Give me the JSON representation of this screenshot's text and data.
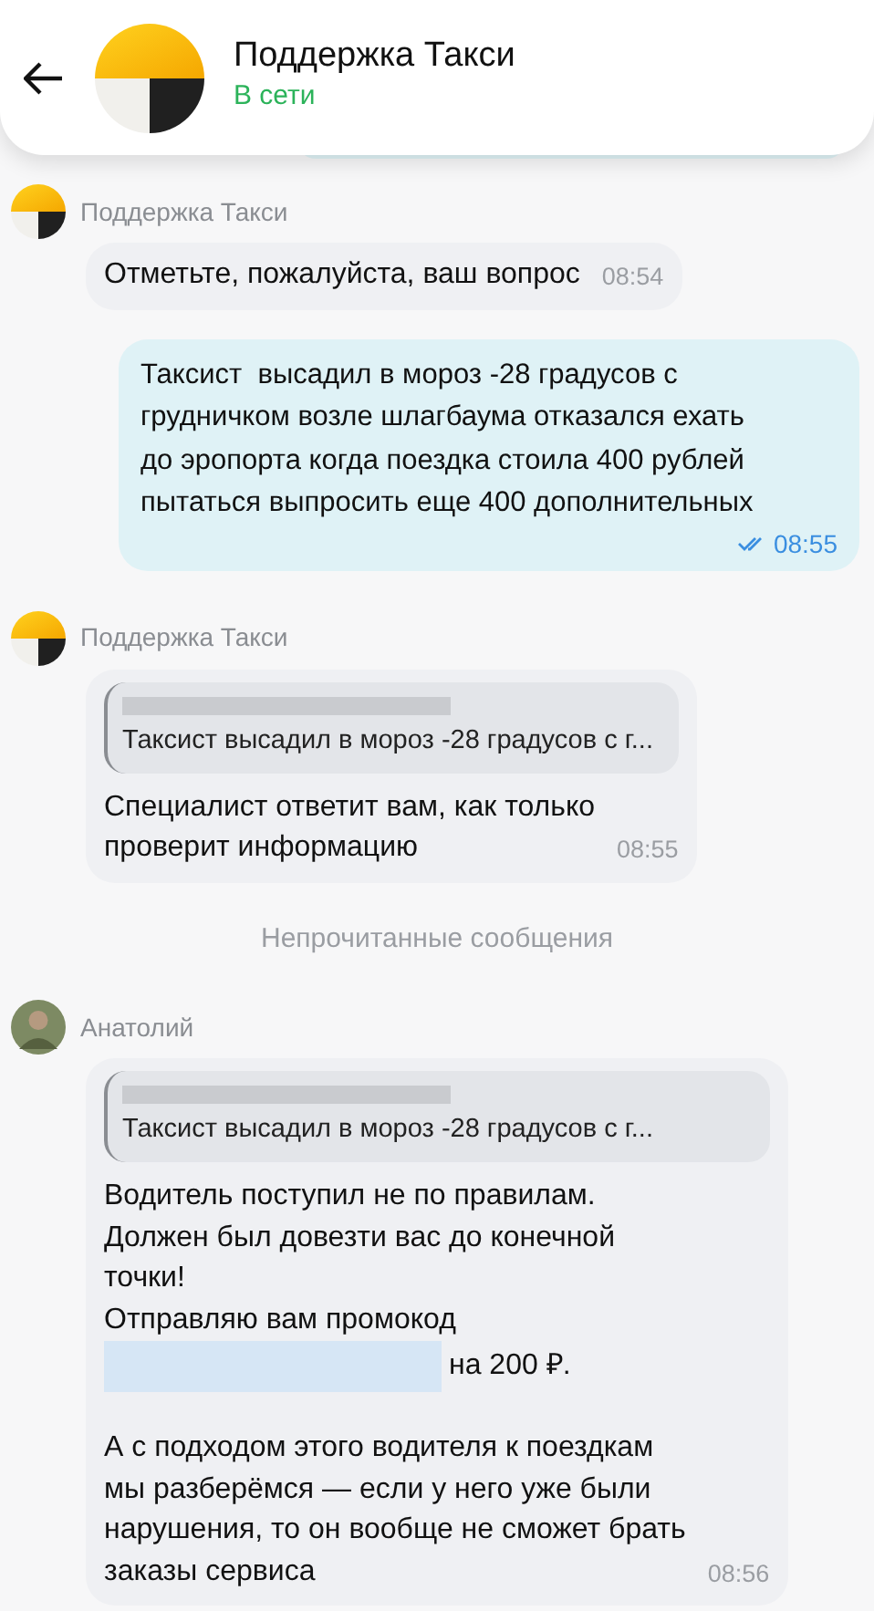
{
  "header": {
    "title": "Поддержка Такси",
    "status": "В сети"
  },
  "messages": [
    {
      "kind": "incoming",
      "sender": "Поддержка Такси",
      "avatar": {
        "kind": "logo"
      },
      "text": "Отметьте, пожалуйста, ваш вопрос",
      "time": "08:54"
    },
    {
      "kind": "outgoing",
      "text": "Таксист  высадил в мороз -28 градусов с\nгрудничком возле шлагбаума отказался ехать\nдо эропорта когда поездка стоила 400 рублей\nпытаться выпросить еще 400 дополнительных",
      "time": "08:55",
      "read": true
    },
    {
      "kind": "incoming",
      "sender": "Поддержка Такси",
      "avatar": {
        "kind": "logo"
      },
      "quote": "Таксист высадил в мороз -28 градусов с г...",
      "text": "Специалист ответит вам, как только\nпроверит информацию",
      "time": "08:55"
    },
    {
      "kind": "divider",
      "text": "Непрочитанные сообщения"
    },
    {
      "kind": "incoming",
      "sender": "Анатолий",
      "avatar": {
        "kind": "photo"
      },
      "quote": "Таксист высадил в мороз -28 градусов с г...",
      "text": "Водитель поступил не по правилам.\nДолжен был довезти вас до конечной\nточки!\nОтправляю вам промокод",
      "promo": "на 200 ₽.",
      "text2": "А с подходом этого водителя к поездкам\nмы разберёмся — если у него уже были\nнарушения, то он вообще не сможет брать\nзаказы сервиса",
      "time": "08:56"
    }
  ]
}
